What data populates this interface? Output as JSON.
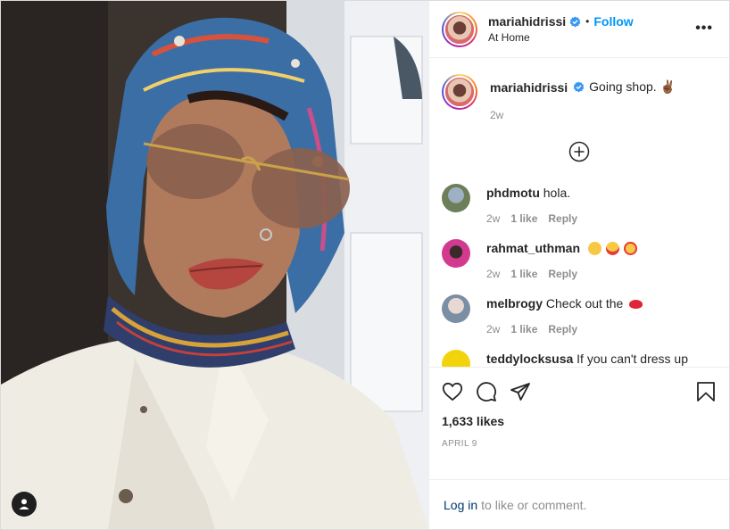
{
  "post": {
    "author": "mariahidrissi",
    "follow_label": "Follow",
    "separator": "•",
    "location": "At Home",
    "more_label": "•••"
  },
  "caption": {
    "username": "mariahidrissi",
    "text": "Going shop. ✌🏾",
    "time": "2w"
  },
  "comments": [
    {
      "username": "phdmotu",
      "text": "hola.",
      "time": "2w",
      "likes": "1 like",
      "reply": "Reply"
    },
    {
      "username": "rahmat_uthman",
      "text": "",
      "time": "2w",
      "likes": "1 like",
      "reply": "Reply"
    },
    {
      "username": "melbrogy",
      "text": "Check out the",
      "time": "2w",
      "likes": "1 like",
      "reply": "Reply"
    },
    {
      "username": "teddylocksusa",
      "text": "If you can't dress up",
      "time": "",
      "likes": "",
      "reply": ""
    }
  ],
  "stats": {
    "likes": "1,633 likes",
    "date": "APRIL 9"
  },
  "footer": {
    "login_label": "Log in",
    "rest": "to like or comment."
  },
  "icons": {
    "heart": "heart-icon",
    "comment": "comment-icon",
    "share": "share-icon",
    "bookmark": "bookmark-icon",
    "verified": "verified-badge-icon",
    "load_more": "plus-circle-icon",
    "user_tag": "user-tag-icon"
  },
  "colors": {
    "follow": "#0095f6",
    "verified": "#3897f0",
    "muted": "#8e8e8e"
  }
}
